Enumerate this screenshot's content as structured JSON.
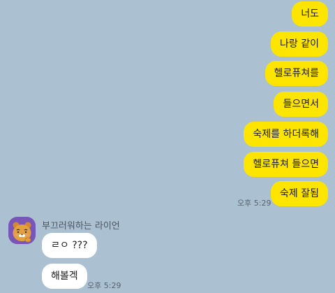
{
  "chat": {
    "outgoing": [
      {
        "text": "너도"
      },
      {
        "text": "나랑 같이"
      },
      {
        "text": "헬로퓨쳐를"
      },
      {
        "text": "들으면서"
      },
      {
        "text": "숙제를 하더록해"
      },
      {
        "text": "헬로퓨쳐 들으면"
      },
      {
        "text": "숙제 잘됨"
      }
    ],
    "outgoing_time": "오후 5:29",
    "incoming": {
      "sender_name": "부끄러워하는 라이언",
      "messages": [
        {
          "text": "ㄹㅇ ???"
        },
        {
          "text": "해볼겍"
        }
      ],
      "time": "오후 5:29"
    }
  },
  "colors": {
    "background": "#abc1d1",
    "outgoing_bubble": "#fee500",
    "incoming_bubble": "#ffffff",
    "avatar_bg": "#7a55b8"
  },
  "icons": {
    "avatar": "ryan-character-icon"
  }
}
